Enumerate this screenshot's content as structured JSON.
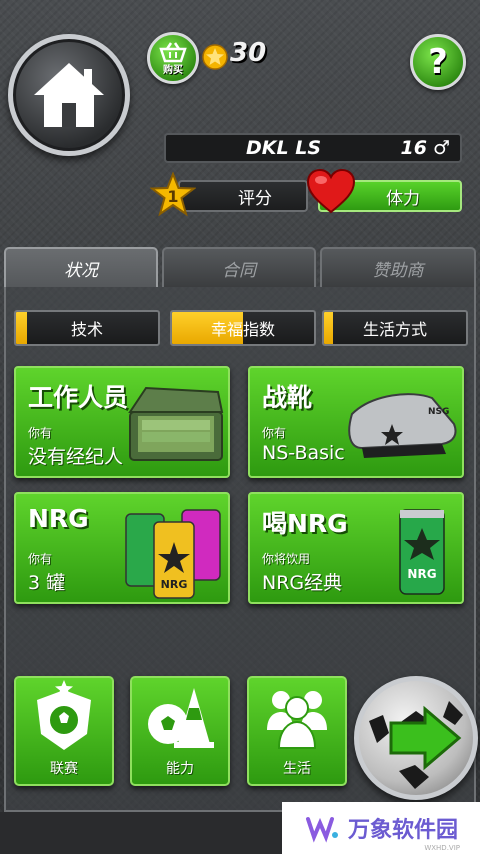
{
  "header": {
    "shop_label": "购买",
    "coins": "30",
    "help_label": "?"
  },
  "player": {
    "name": "DKL LS",
    "age": "16",
    "gender_symbol": "♂",
    "rank": "1",
    "rating_label": "评分",
    "energy_label": "体力"
  },
  "tabs": [
    {
      "label": "状况",
      "active": true
    },
    {
      "label": "合同",
      "active": false
    },
    {
      "label": "赞助商",
      "active": false
    }
  ],
  "subtabs": [
    {
      "label": "技术",
      "fill": 0.08
    },
    {
      "label": "幸福指数",
      "fill": 0.5
    },
    {
      "label": "生活方式",
      "fill": 0.06
    }
  ],
  "cards": {
    "staff": {
      "title": "工作人员",
      "sub": "你有",
      "value": "没有经纪人"
    },
    "boots": {
      "title": "战靴",
      "sub": "你有",
      "value": "NS-Basic",
      "icon_text": "NSG"
    },
    "nrg": {
      "title": "NRG",
      "sub": "你有",
      "value": "3 罐",
      "can_text": "NRG"
    },
    "drink": {
      "title": "喝NRG",
      "sub": "你将饮用",
      "value": "NRG经典",
      "can_text": "NRG"
    }
  },
  "nav": {
    "league_label": "联赛",
    "ability_label": "能力",
    "life_label": "生活"
  },
  "watermark": {
    "text": "万象软件园",
    "small": "WXHD.VIP"
  },
  "colors": {
    "green": "#4cc41f",
    "yellow": "#f5b800",
    "dark": "#1a1b1c"
  }
}
